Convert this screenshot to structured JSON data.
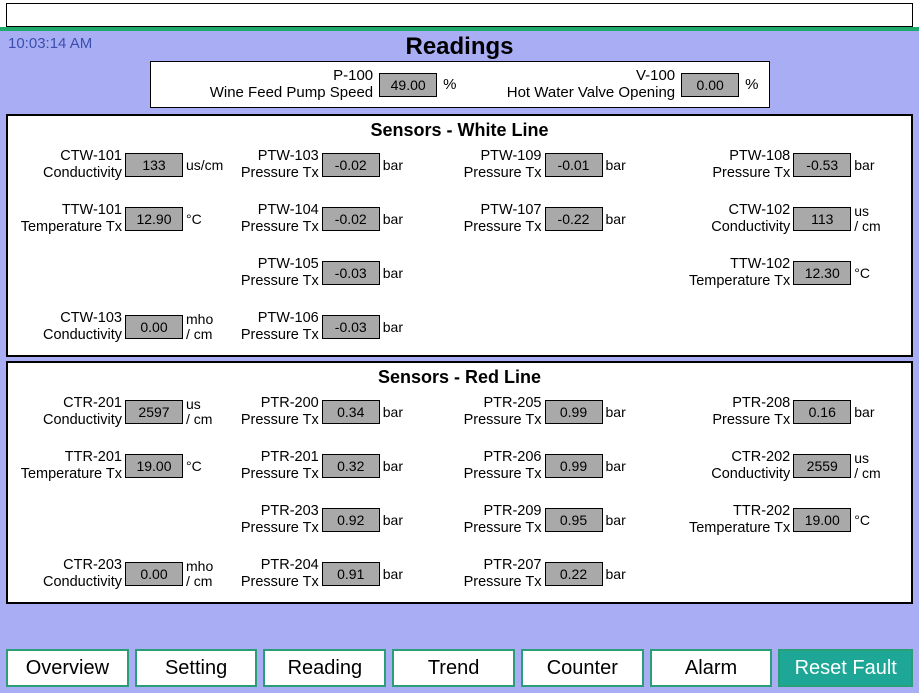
{
  "time": "10:03:14 AM",
  "title": "Readings",
  "speed_box": {
    "p100_tag": "P-100",
    "p100_desc": "Wine Feed Pump Speed",
    "p100_val": "49.00",
    "p100_unit": "%",
    "v100_tag": "V-100",
    "v100_desc": "Hot Water Valve Opening",
    "v100_val": "0.00",
    "v100_unit": "%"
  },
  "panel_white_title": "Sensors - White Line",
  "panel_red_title": "Sensors - Red Line",
  "white": {
    "r1c1": {
      "tag": "CTW-101",
      "desc": "Conductivity",
      "val": "133",
      "unit": "us/cm"
    },
    "r1c2": {
      "tag": "PTW-103",
      "desc": "Pressure Tx",
      "val": "-0.02",
      "unit": "bar"
    },
    "r1c3": {
      "tag": "PTW-109",
      "desc": "Pressure Tx",
      "val": "-0.01",
      "unit": "bar"
    },
    "r1c4": {
      "tag": "PTW-108",
      "desc": "Pressure Tx",
      "val": "-0.53",
      "unit": "bar"
    },
    "r2c1": {
      "tag": "TTW-101",
      "desc": "Temperature Tx",
      "val": "12.90",
      "unit": "°C"
    },
    "r2c2": {
      "tag": "PTW-104",
      "desc": "Pressure Tx",
      "val": "-0.02",
      "unit": "bar"
    },
    "r2c3": {
      "tag": "PTW-107",
      "desc": "Pressure Tx",
      "val": "-0.22",
      "unit": "bar"
    },
    "r2c4": {
      "tag": "CTW-102",
      "desc": "Conductivity",
      "val": "113",
      "unit_l1": "us",
      "unit_l2": "/ cm"
    },
    "r3c2": {
      "tag": "PTW-105",
      "desc": "Pressure Tx",
      "val": "-0.03",
      "unit": "bar"
    },
    "r3c4": {
      "tag": "TTW-102",
      "desc": "Temperature Tx",
      "val": "12.30",
      "unit": "°C"
    },
    "r4c1": {
      "tag": "CTW-103",
      "desc": "Conductivity",
      "val": "0.00",
      "unit_l1": "mho",
      "unit_l2": "/ cm"
    },
    "r4c2": {
      "tag": "PTW-106",
      "desc": "Pressure Tx",
      "val": "-0.03",
      "unit": "bar"
    }
  },
  "red": {
    "r1c1": {
      "tag": "CTR-201",
      "desc": "Conductivity",
      "val": "2597",
      "unit_l1": "us",
      "unit_l2": "/ cm"
    },
    "r1c2": {
      "tag": "PTR-200",
      "desc": "Pressure Tx",
      "val": "0.34",
      "unit": "bar"
    },
    "r1c3": {
      "tag": "PTR-205",
      "desc": "Pressure Tx",
      "val": "0.99",
      "unit": "bar"
    },
    "r1c4": {
      "tag": "PTR-208",
      "desc": "Pressure Tx",
      "val": "0.16",
      "unit": "bar"
    },
    "r2c1": {
      "tag": "TTR-201",
      "desc": "Temperature Tx",
      "val": "19.00",
      "unit": "°C"
    },
    "r2c2": {
      "tag": "PTR-201",
      "desc": "Pressure Tx",
      "val": "0.32",
      "unit": "bar"
    },
    "r2c3": {
      "tag": "PTR-206",
      "desc": "Pressure Tx",
      "val": "0.99",
      "unit": "bar"
    },
    "r2c4": {
      "tag": "CTR-202",
      "desc": "Conductivity",
      "val": "2559",
      "unit_l1": "us",
      "unit_l2": "/ cm"
    },
    "r3c2": {
      "tag": "PTR-203",
      "desc": "Pressure Tx",
      "val": "0.92",
      "unit": "bar"
    },
    "r3c3": {
      "tag": "PTR-209",
      "desc": "Pressure Tx",
      "val": "0.95",
      "unit": "bar"
    },
    "r3c4": {
      "tag": "TTR-202",
      "desc": "Temperature Tx",
      "val": "19.00",
      "unit": "°C"
    },
    "r4c1": {
      "tag": "CTR-203",
      "desc": "Conductivity",
      "val": "0.00",
      "unit_l1": "mho",
      "unit_l2": "/ cm"
    },
    "r4c2": {
      "tag": "PTR-204",
      "desc": "Pressure Tx",
      "val": "0.91",
      "unit": "bar"
    },
    "r4c3": {
      "tag": "PTR-207",
      "desc": "Pressure Tx",
      "val": "0.22",
      "unit": "bar"
    }
  },
  "nav": {
    "overview": "Overview",
    "setting": "Setting",
    "reading": "Reading",
    "trend": "Trend",
    "counter": "Counter",
    "alarm": "Alarm",
    "reset": "Reset Fault"
  }
}
